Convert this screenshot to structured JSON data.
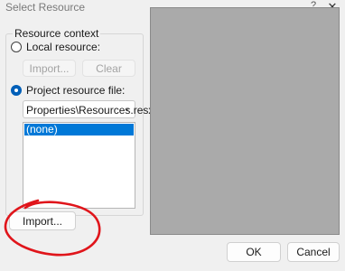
{
  "window": {
    "title": "Select Resource",
    "help_label": "?",
    "close_label": "✕"
  },
  "resource_context": {
    "legend": "Resource context",
    "local_resource": {
      "label": "Local resource:",
      "selected": false,
      "import_label": "Import...",
      "clear_label": "Clear"
    },
    "project_resource": {
      "label": "Project resource file:",
      "selected": true,
      "file_value": "Properties\\Resources.resx",
      "list_items": [
        "(none)"
      ],
      "selected_item": "(none)"
    }
  },
  "import_button_label": "Import...",
  "annotation_color": "#e0151b",
  "footer": {
    "ok_label": "OK",
    "cancel_label": "Cancel"
  }
}
